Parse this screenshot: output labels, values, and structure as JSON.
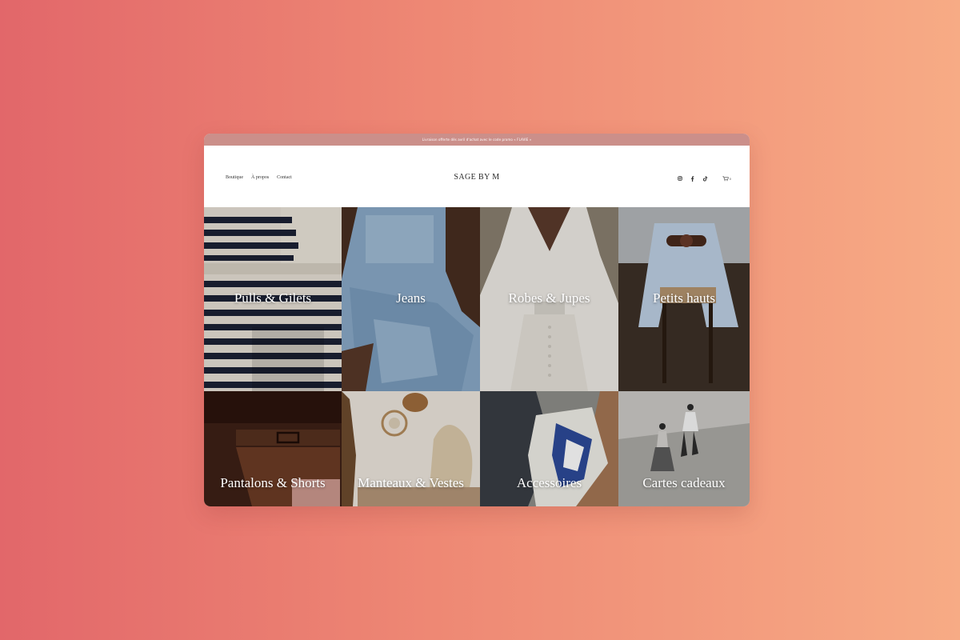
{
  "background": {
    "gradient_start": "#e2676a",
    "gradient_end": "#f7ab85"
  },
  "announcement": {
    "text": "Livraison offerte dès avril d'achat avec le code promo « FLAVIE »"
  },
  "header": {
    "nav": [
      {
        "label": "Boutique"
      },
      {
        "label": "À propos"
      },
      {
        "label": "Contact"
      }
    ],
    "logo": "SAGE BY M",
    "social_icons": [
      "instagram-icon",
      "facebook-icon",
      "tiktok-icon"
    ],
    "cart": {
      "icon": "cart-icon",
      "count": "0"
    }
  },
  "categories": [
    {
      "label": "Pulls & Gilets"
    },
    {
      "label": "Jeans"
    },
    {
      "label": "Robes & Jupes"
    },
    {
      "label": "Petits hauts"
    },
    {
      "label": "Pantalons & Shorts"
    },
    {
      "label": "Manteaux & Vestes"
    },
    {
      "label": "Accessoires"
    },
    {
      "label": "Cartes cadeaux"
    }
  ]
}
